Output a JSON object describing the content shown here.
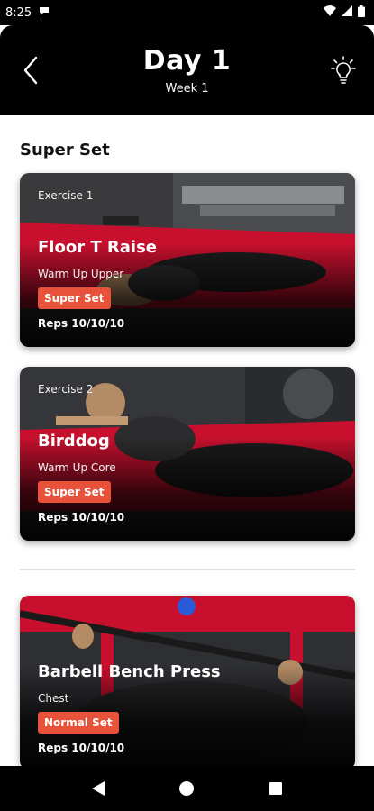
{
  "status_bar": {
    "time": "8:25"
  },
  "header": {
    "title": "Day 1",
    "subtitle": "Week 1"
  },
  "section": {
    "title": "Super Set"
  },
  "exercises": [
    {
      "label": "Exercise 1",
      "name": "Floor T Raise",
      "category": "Warm Up Upper",
      "badge": "Super Set",
      "reps": "Reps 10/10/10"
    },
    {
      "label": "Exercise 2",
      "name": "Birddog",
      "category": "Warm Up Core",
      "badge": "Super Set",
      "reps": "Reps 10/10/10"
    },
    {
      "label": "",
      "name": "Barbell Bench Press",
      "category": "Chest",
      "badge": "Normal Set",
      "reps": "Reps 10/10/10"
    }
  ],
  "colors": {
    "accent": "#e8513a",
    "header_bg": "#000000",
    "gym_red": "#c8102e"
  },
  "icons": [
    "back-chevron-icon",
    "lightbulb-icon",
    "wifi-icon",
    "battery-icon",
    "nav-back-icon",
    "nav-home-icon",
    "nav-recents-icon"
  ]
}
